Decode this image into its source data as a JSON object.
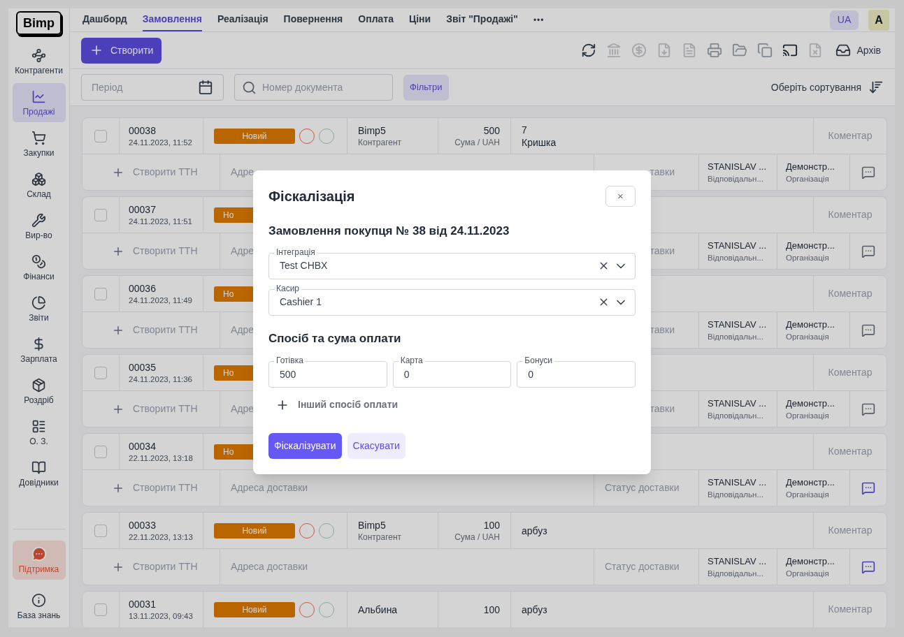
{
  "sidebar": {
    "logo": "Bimp",
    "items": [
      {
        "label": "Контрагенти",
        "selected": false
      },
      {
        "label": "Продажі",
        "selected": true
      },
      {
        "label": "Закупки",
        "selected": false
      },
      {
        "label": "Склад",
        "selected": false
      },
      {
        "label": "Вир-во",
        "selected": false
      },
      {
        "label": "Фінанси",
        "selected": false
      },
      {
        "label": "Звіти",
        "selected": false
      },
      {
        "label": "Зарплата",
        "selected": false
      },
      {
        "label": "Роздріб",
        "selected": false
      },
      {
        "label": "О. З.",
        "selected": false
      },
      {
        "label": "Довідники",
        "selected": false
      }
    ],
    "bottom_items": [
      {
        "label": "Підтримка",
        "kind": "support"
      },
      {
        "label": "База знань",
        "kind": "info"
      }
    ]
  },
  "tabs": [
    {
      "label": "Дашборд",
      "selected": false
    },
    {
      "label": "Замовлення",
      "selected": true
    },
    {
      "label": "Реалізація",
      "selected": false
    },
    {
      "label": "Повернення",
      "selected": false
    },
    {
      "label": "Оплата",
      "selected": false
    },
    {
      "label": "Ціни",
      "selected": false
    },
    {
      "label": "Звіт \"Продажі\"",
      "selected": false
    }
  ],
  "more": "•••",
  "language": "UA",
  "avatar": "A",
  "toolbar": {
    "create": "Створити",
    "archive": "Архів"
  },
  "filters": {
    "period_placeholder": "Період",
    "search_placeholder": "Номер документа",
    "filters_button": "Фільтри",
    "sort": "Оберіть сортування"
  },
  "orders": [
    {
      "checked": false,
      "number": "00038",
      "date": "24.11.2023, 11:52",
      "status": "Новий",
      "top_covered": false,
      "bottom_covered": true,
      "circles": [
        {
          "color": "#d0583f"
        },
        {
          "color": "#88ab98"
        }
      ],
      "client": "Bimp5",
      "client_label": "Контрагент",
      "sum": "500",
      "sum_label": "Сума / UAH",
      "comment_lines": [
        "7",
        "Кришка"
      ],
      "comment": "Коментар",
      "ttn": "Створити ТТН",
      "address": "Адре",
      "delivery_status": "тавки",
      "person": "STANISLAV ...",
      "person_label": "Відповідальн...",
      "org": "Демонстр...",
      "org_label": "Організація",
      "active": false
    },
    {
      "checked": false,
      "number": "00037",
      "date": "24.11.2023, 11:51",
      "status": "Но",
      "top_covered": true,
      "bottom_covered": true,
      "comment": "Коментар",
      "ttn": "Створити ТТН",
      "address": "Адре",
      "delivery_status": "тавки",
      "person": "STANISLAV ...",
      "person_label": "Відповідальн...",
      "org": "Демонстр...",
      "org_label": "Організація",
      "active": false
    },
    {
      "checked": false,
      "number": "00036",
      "date": "24.11.2023, 11:49",
      "status": "Но",
      "top_covered": true,
      "bottom_covered": true,
      "comment": "Коментар",
      "ttn": "Створити ТТН",
      "address": "Адре",
      "delivery_status": "тавки",
      "person": "STANISLAV ...",
      "person_label": "Відповідальн...",
      "org": "Демонстр...",
      "org_label": "Організація",
      "active": false
    },
    {
      "checked": false,
      "number": "00035",
      "date": "24.11.2023, 11:36",
      "status": "Но",
      "top_covered": true,
      "bottom_covered": true,
      "comment": "Коментар",
      "ttn": "Створити ТТН",
      "address": "Адре",
      "delivery_status": "тавки",
      "person": "STANISLAV ...",
      "person_label": "Відповідальн...",
      "org": "Демонстр...",
      "org_label": "Організація",
      "active": false
    },
    {
      "checked": false,
      "number": "00034",
      "date": "22.11.2023, 13:18",
      "status": "Но",
      "top_covered": true,
      "bottom_covered": false,
      "comment": "Коментар",
      "ttn": "Створити ТТН",
      "address": "Адреса доставки",
      "delivery_status": "Статус доставки",
      "person": "STANISLAV ...",
      "person_label": "Відповідальн...",
      "org": "Демонстр...",
      "org_label": "Організація",
      "active": true
    },
    {
      "checked": false,
      "number": "00033",
      "date": "22.11.2023, 13:13",
      "status": "Новий",
      "top_covered": false,
      "bottom_covered": false,
      "circles": [
        {
          "color": "#d0583f"
        },
        {
          "color": "#88ab98"
        }
      ],
      "client": "Bimp5",
      "client_label": "Контрагент",
      "sum": "100",
      "sum_label": "Сума / UAH",
      "comment_lines": [
        "арбуз"
      ],
      "comment": "Коментар",
      "ttn": "Створити ТТН",
      "address": "Адреса доставки",
      "delivery_status": "Статус доставки",
      "person": "STANISLAV ...",
      "person_label": "Відповідальн...",
      "org": "Демонстр...",
      "org_label": "Організація",
      "active": true
    },
    {
      "checked": false,
      "number": "00031",
      "date": "13.11.2023, 09:43",
      "status": "Новий",
      "top_covered": false,
      "circles": [
        {
          "color": "#d0583f"
        },
        {
          "color": "#88ab98"
        }
      ],
      "client": "Альбина",
      "sum": "100",
      "comment_lines": [
        "арбуз"
      ],
      "comment": "Коментар"
    }
  ],
  "dialog": {
    "title": "Фіскалізація",
    "close": "×",
    "subtitle": "Замовлення покупця № 38 від 24.11.2023",
    "selects": [
      {
        "label": "Інтеграція",
        "value": "Test CHBX"
      },
      {
        "label": "Касир",
        "value": "Cashier 1"
      }
    ],
    "payment_title": "Спосіб та сума оплати",
    "payments": [
      {
        "label": "Готівка",
        "value": "500"
      },
      {
        "label": "Карта",
        "value": "0"
      },
      {
        "label": "Бонуси",
        "value": "0"
      }
    ],
    "add_payment": "Інший спосіб оплати",
    "submit": "Фіскалізувати",
    "cancel": "Скасувати"
  }
}
